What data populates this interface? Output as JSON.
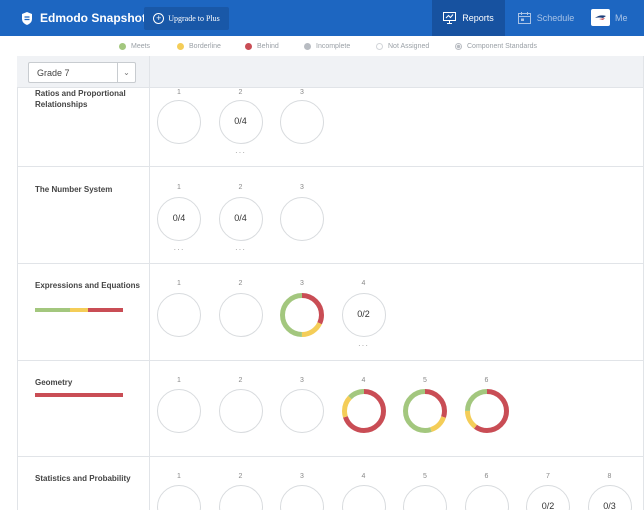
{
  "header": {
    "brand": "Edmodo Snapshot",
    "upgrade_label": "Upgrade to Plus",
    "nav": {
      "reports": "Reports",
      "schedule": "Schedule",
      "user": "Me"
    }
  },
  "legend": [
    {
      "label": "Meets",
      "color": "#a3c77e",
      "style": "fill"
    },
    {
      "label": "Borderline",
      "color": "#f4cd58",
      "style": "fill"
    },
    {
      "label": "Behind",
      "color": "#c94d55",
      "style": "fill"
    },
    {
      "label": "Incomplete",
      "color": "#b8bcc2",
      "style": "fill"
    },
    {
      "label": "Not Assigned",
      "color": "#d2d5d9",
      "style": "ring"
    },
    {
      "label": "Component Standards",
      "color": "#b8bcc2",
      "style": "ring-dot"
    }
  ],
  "grade_selector": {
    "value": "Grade 7"
  },
  "colors": {
    "meets": "#a3c77e",
    "borderline": "#f4cd58",
    "behind": "#c94d55",
    "empty_ring": "#d8dbde"
  },
  "domains": [
    {
      "name": "Ratios and Proportional Relationships",
      "bar": [],
      "standards": [
        {
          "num": "1",
          "score": "",
          "more": false,
          "segments": []
        },
        {
          "num": "2",
          "score": "0/4",
          "more": true,
          "segments": []
        },
        {
          "num": "3",
          "score": "",
          "more": false,
          "segments": []
        }
      ]
    },
    {
      "name": "The Number System",
      "bar": [],
      "standards": [
        {
          "num": "1",
          "score": "0/4",
          "more": true,
          "segments": []
        },
        {
          "num": "2",
          "score": "0/4",
          "more": true,
          "segments": []
        },
        {
          "num": "3",
          "score": "",
          "more": false,
          "segments": []
        }
      ]
    },
    {
      "name": "Expressions and Equations",
      "bar": [
        {
          "status": "meets",
          "fraction": 0.4
        },
        {
          "status": "borderline",
          "fraction": 0.2
        },
        {
          "status": "behind",
          "fraction": 0.4
        }
      ],
      "standards": [
        {
          "num": "1",
          "score": "",
          "more": false,
          "segments": []
        },
        {
          "num": "2",
          "score": "",
          "more": false,
          "segments": []
        },
        {
          "num": "3",
          "score": "",
          "more": false,
          "segments": [
            {
              "status": "behind",
              "fraction": 0.32
            },
            {
              "status": "borderline",
              "fraction": 0.18
            },
            {
              "status": "meets",
              "fraction": 0.5
            }
          ]
        },
        {
          "num": "4",
          "score": "0/2",
          "more": true,
          "segments": []
        }
      ]
    },
    {
      "name": "Geometry",
      "bar": [
        {
          "status": "behind",
          "fraction": 1.0
        }
      ],
      "standards": [
        {
          "num": "1",
          "score": "",
          "more": false,
          "segments": []
        },
        {
          "num": "2",
          "score": "",
          "more": false,
          "segments": []
        },
        {
          "num": "3",
          "score": "",
          "more": false,
          "segments": []
        },
        {
          "num": "4",
          "score": "",
          "more": false,
          "segments": [
            {
              "status": "behind",
              "fraction": 0.7
            },
            {
              "status": "borderline",
              "fraction": 0.17
            },
            {
              "status": "meets",
              "fraction": 0.13
            }
          ]
        },
        {
          "num": "5",
          "score": "",
          "more": false,
          "segments": [
            {
              "status": "behind",
              "fraction": 0.3
            },
            {
              "status": "borderline",
              "fraction": 0.15
            },
            {
              "status": "meets",
              "fraction": 0.55
            }
          ]
        },
        {
          "num": "6",
          "score": "",
          "more": false,
          "segments": [
            {
              "status": "behind",
              "fraction": 0.6
            },
            {
              "status": "borderline",
              "fraction": 0.15
            },
            {
              "status": "meets",
              "fraction": 0.25
            }
          ]
        }
      ]
    },
    {
      "name": "Statistics and Probability",
      "bar": [],
      "standards": [
        {
          "num": "1",
          "score": "",
          "more": false,
          "segments": []
        },
        {
          "num": "2",
          "score": "",
          "more": false,
          "segments": []
        },
        {
          "num": "3",
          "score": "",
          "more": false,
          "segments": []
        },
        {
          "num": "4",
          "score": "",
          "more": false,
          "segments": []
        },
        {
          "num": "5",
          "score": "",
          "more": false,
          "segments": []
        },
        {
          "num": "6",
          "score": "",
          "more": false,
          "segments": []
        },
        {
          "num": "7",
          "score": "0/2",
          "more": false,
          "segments": []
        },
        {
          "num": "8",
          "score": "0/3",
          "more": false,
          "segments": []
        }
      ]
    }
  ]
}
